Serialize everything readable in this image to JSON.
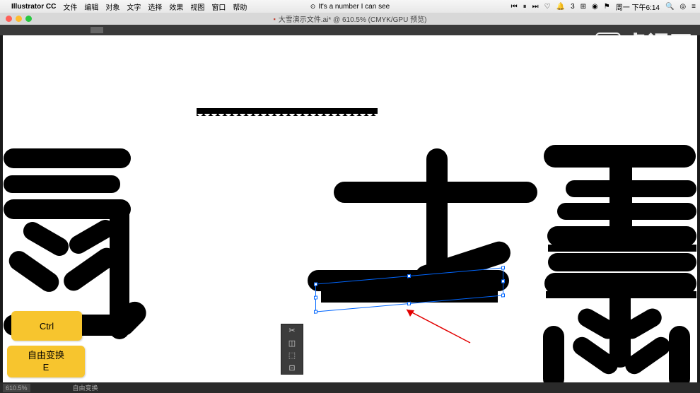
{
  "menubar": {
    "app_name": "Illustrator CC",
    "items": [
      "文件",
      "编辑",
      "对象",
      "文字",
      "选择",
      "效果",
      "视图",
      "窗口",
      "帮助"
    ],
    "now_playing": "It's a number I can see",
    "right": {
      "battery": "3",
      "day_time": "周一 下午6:14"
    }
  },
  "document": {
    "title": "大雪演示文件.ai* @ 610.5% (CMYK/GPU 预览)"
  },
  "keys": {
    "ctrl": "Ctrl",
    "free_transform_label": "自由变换",
    "free_transform_key": "E"
  },
  "statusbar": {
    "zoom": "610.5%",
    "tool": "自由变换"
  },
  "watermark": {
    "text": "虎课网"
  },
  "panel": {
    "tools": [
      "free-transform",
      "perspective",
      "distort",
      "constrain"
    ]
  }
}
